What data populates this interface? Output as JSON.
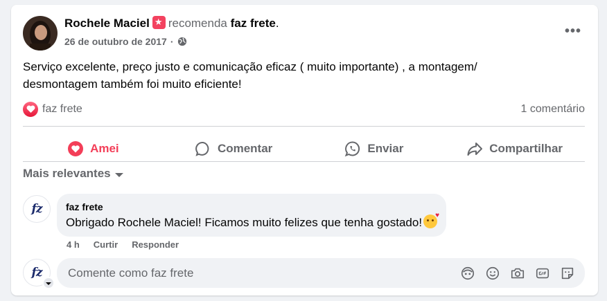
{
  "post": {
    "author": "Rochele Maciel",
    "verb": "recomenda",
    "page_name": "faz frete",
    "period": ".",
    "date": "26 de outubro de 2017",
    "separator": "·",
    "text_line1": "Serviço excelente, preço justo e comunicação eficaz ( muito importante) , a montagem/",
    "text_line2": "desmontagem também foi muito eficiente!"
  },
  "reactions": {
    "reactor": "faz frete",
    "comment_count": "1 comentário"
  },
  "actions": {
    "love": "Amei",
    "comment": "Comentar",
    "send": "Enviar",
    "share": "Compartilhar"
  },
  "sort": {
    "label": "Mais relevantes"
  },
  "comment": {
    "avatar_text": "fz",
    "name": "faz frete",
    "text": "Obrigado Rochele Maciel! Ficamos muito felizes que tenha gostado!",
    "time": "4 h",
    "like": "Curtir",
    "reply": "Responder"
  },
  "composer": {
    "avatar_text": "fz",
    "placeholder": "Comente como faz frete",
    "icons": [
      "avatar-sticker-icon",
      "emoji-icon",
      "camera-icon",
      "gif-icon",
      "sticker-icon"
    ]
  },
  "colors": {
    "love": "#f33e58",
    "secondary_text": "#65676b",
    "background": "#f0f2f5"
  }
}
